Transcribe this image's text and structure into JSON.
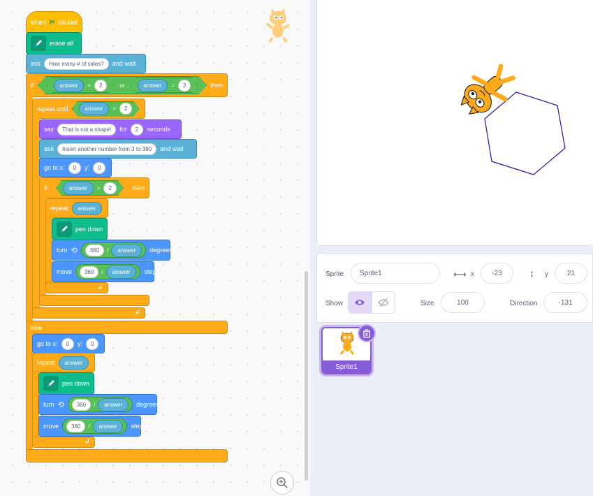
{
  "script": {
    "when_flag": {
      "pre": "when",
      "post": "clicked"
    },
    "erase_all": "erase all",
    "ask1": {
      "label": "ask",
      "text": "How many # of sides?",
      "suffix": "and wait"
    },
    "if1": {
      "label": "if",
      "then": "then",
      "else": "else",
      "cond_left": {
        "rep": "answer",
        "op": "<",
        "val": "2"
      },
      "join": "or",
      "cond_right": {
        "rep": "answer",
        "op": "=",
        "val": "2"
      }
    },
    "repeat_until": {
      "label": "repeat until",
      "rep": "answer",
      "op": ">",
      "val": "2"
    },
    "say": {
      "label": "say",
      "text": "That is not a shape!",
      "for": "for",
      "secs": "2",
      "unit": "seconds"
    },
    "ask2": {
      "label": "ask",
      "text": "Insert another number from 3 to 380",
      "suffix": "and wait"
    },
    "goto1": {
      "label": "go to x:",
      "x": "0",
      "ylabel": "y:",
      "y": "0"
    },
    "if2": {
      "label": "if",
      "rep": "answer",
      "op": ">",
      "val": "2",
      "then": "then"
    },
    "repeat1": {
      "label": "repeat",
      "rep": "answer"
    },
    "pen_down": "pen down",
    "turn": {
      "label": "turn",
      "num": "360",
      "div": "/",
      "rep": "answer",
      "unit": "degrees"
    },
    "move": {
      "label": "move",
      "num": "360",
      "div": "/",
      "rep": "answer",
      "unit": "steps"
    },
    "goto2": {
      "label": "go to x:",
      "x": "0",
      "ylabel": "y:",
      "y": "0"
    },
    "repeat2": {
      "label": "repeat",
      "rep": "answer"
    }
  },
  "sprite_info": {
    "sprite_label": "Sprite",
    "sprite_name": "Sprite1",
    "x_label": "x",
    "x": "-23",
    "y_label": "y",
    "y": "21",
    "show_label": "Show",
    "size_label": "Size",
    "size": "100",
    "direction_label": "Direction",
    "direction": "-131"
  },
  "sprite_tile": {
    "name": "Sprite1"
  },
  "colors": {
    "events": "#ffbf00",
    "pen": "#0fbd8c",
    "sensing": "#5cb1d6",
    "control": "#ffab19",
    "motion": "#4c97ff",
    "looks": "#9966ff",
    "operators": "#59c059",
    "selected": "#855cd6",
    "pen_trail": "#1a1aa6"
  },
  "icons": [
    "green-flag-icon",
    "pen-icon",
    "rotate-left-icon",
    "loop-arrow-icon",
    "zoom-in-icon",
    "eye-icon",
    "eye-slash-icon",
    "trash-icon",
    "horizontal-arrows-icon",
    "vertical-arrows-icon",
    "cat-sprite-icon"
  ]
}
